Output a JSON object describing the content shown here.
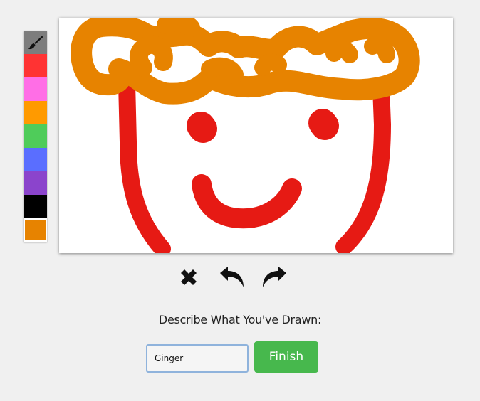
{
  "palette": {
    "brush_icon": "paintbrush-icon",
    "colors": [
      {
        "name": "red",
        "hex": "#ff3333"
      },
      {
        "name": "pink",
        "hex": "#ff6ee6"
      },
      {
        "name": "orange",
        "hex": "#ff9a00"
      },
      {
        "name": "green",
        "hex": "#4fcc5a"
      },
      {
        "name": "blue",
        "hex": "#5a6eff"
      },
      {
        "name": "purple",
        "hex": "#8b44cc"
      },
      {
        "name": "black",
        "hex": "#000000"
      }
    ],
    "current_color": "#e78300"
  },
  "canvas": {
    "stroke_colors": {
      "hair": "#e78300",
      "face": "#e61a14"
    }
  },
  "tools": {
    "clear_icon": "close-x-icon",
    "undo_icon": "undo-arrow-icon",
    "redo_icon": "redo-arrow-icon"
  },
  "prompt": {
    "label": "Describe What You've Drawn:"
  },
  "description": {
    "value": "Ginger"
  },
  "finish_button": {
    "label": "Finish",
    "color": "#47b84d"
  }
}
